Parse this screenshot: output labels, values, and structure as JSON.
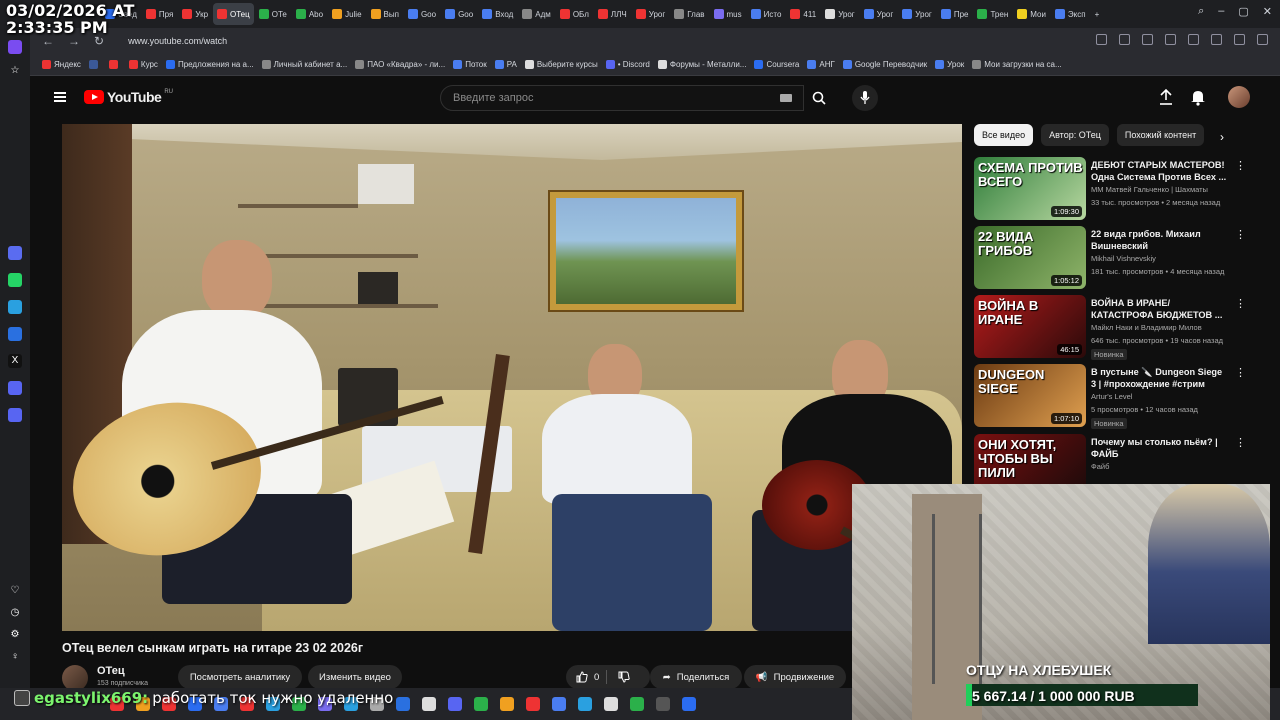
{
  "overlay_timestamp": {
    "date": "03/02/2026 AT",
    "time": "2:33:35 PM"
  },
  "browser": {
    "tabs": [
      {
        "label": "Свед",
        "color": "#2b6cf0"
      },
      {
        "label": "Пря",
        "color": "#e33"
      },
      {
        "label": "Укр",
        "color": "#e33"
      },
      {
        "label": "ОТец",
        "color": "#e33",
        "active": true
      },
      {
        "label": "ОТе",
        "color": "#2bb04a"
      },
      {
        "label": "Abo",
        "color": "#2bb04a"
      },
      {
        "label": "Julie",
        "color": "#f0a020"
      },
      {
        "label": "Вып",
        "color": "#f0a020"
      },
      {
        "label": "Goo",
        "color": "#4a7df0"
      },
      {
        "label": "Goo",
        "color": "#4a7df0"
      },
      {
        "label": "Вход",
        "color": "#4a7df0"
      },
      {
        "label": "Адм",
        "color": "#888"
      },
      {
        "label": "ОБл",
        "color": "#e33"
      },
      {
        "label": "ЛЛЧ",
        "color": "#e33"
      },
      {
        "label": "Урог",
        "color": "#e33"
      },
      {
        "label": "Глав",
        "color": "#888"
      },
      {
        "label": "mus",
        "color": "#7a6cf0"
      },
      {
        "label": "Исто",
        "color": "#4a7df0"
      },
      {
        "label": "411",
        "color": "#e33"
      },
      {
        "label": "Урог",
        "color": "#ddd"
      },
      {
        "label": "Урог",
        "color": "#4a7df0"
      },
      {
        "label": "Урог",
        "color": "#4a7df0"
      },
      {
        "label": "Пре",
        "color": "#4a7df0"
      },
      {
        "label": "Трен",
        "color": "#2bb04a"
      },
      {
        "label": "Мои",
        "color": "#f0d020"
      },
      {
        "label": "Эксп",
        "color": "#4a7df0"
      }
    ],
    "new_tab": "+",
    "url": "www.youtube.com/watch",
    "bookmarks": [
      {
        "label": "Яндекс",
        "color": "#e33"
      },
      {
        "label": "",
        "color": "#3b5998"
      },
      {
        "label": "",
        "color": "#e33"
      },
      {
        "label": "Курс",
        "color": "#e33"
      },
      {
        "label": "Предложения на а...",
        "color": "#2b6cf0"
      },
      {
        "label": "Личный кабинет а...",
        "color": "#888"
      },
      {
        "label": "ПАО «Квадра» - ли...",
        "color": "#888"
      },
      {
        "label": "Поток",
        "color": "#4a7df0"
      },
      {
        "label": "PA",
        "color": "#4a7df0"
      },
      {
        "label": "Выберите курсы",
        "color": "#ddd"
      },
      {
        "label": "• Discord",
        "color": "#5865f2"
      },
      {
        "label": "Форумы - Металли...",
        "color": "#ddd"
      },
      {
        "label": "Coursera",
        "color": "#2b6cf0"
      },
      {
        "label": "АНГ",
        "color": "#4a7df0"
      },
      {
        "label": "Google Переводчик",
        "color": "#4a7df0"
      },
      {
        "label": "Урок",
        "color": "#4a7df0"
      },
      {
        "label": "Мои загрузки на са...",
        "color": "#888"
      }
    ]
  },
  "youtube": {
    "logo_text": "YouTube",
    "logo_region": "RU",
    "search_placeholder": "Введите запрос",
    "video_title": "ОТец велел сынкам играть на гитаре 23 02 2026г",
    "channel_name": "ОТец",
    "channel_subs": "153 подписчика",
    "buttons": {
      "analytics": "Посмотреть аналитику",
      "edit": "Изменить видео",
      "like_count": "0",
      "share": "Поделиться",
      "promote": "Продвижение"
    },
    "chips": [
      "Все видео",
      "Автор: ОТец",
      "Похожий контент"
    ],
    "recommendations": [
      {
        "title": "ДЕБЮТ СТАРЫХ МАСТЕРОВ! Одна Система Против Всех ...",
        "channel": "ММ Матвей Гальченко | Шахматы",
        "meta": "33 тыс. просмотров • 2 месяца назад",
        "duration": "1:09:30",
        "thumb_text": "СХЕМА ПРОТИВ ВСЕГО",
        "thumb_bg": "linear-gradient(135deg,#2f7d3a,#b7d7a0)",
        "badge": ""
      },
      {
        "title": "22 вида грибов. Михаил Вишневский",
        "channel": "Mikhail Vishnevskiy",
        "meta": "181 тыс. просмотров • 4 месяца назад",
        "duration": "1:05:12",
        "thumb_text": "22 ВИДА ГРИБОВ",
        "thumb_bg": "linear-gradient(135deg,#3b6b2a,#8fb46a)",
        "badge": ""
      },
      {
        "title": "ВОЙНА В ИРАНЕ/ КАТАСТРОФА БЮДЖЕТОВ ...",
        "channel": "Майкл Наки  и Владимир Милов",
        "meta": "646 тыс. просмотров • 19 часов назад",
        "duration": "46:15",
        "thumb_text": "ВОЙНА В ИРАНЕ",
        "thumb_bg": "linear-gradient(135deg,#b31b1b,#2a0a0a)",
        "badge": "Новинка"
      },
      {
        "title": "В пустыне 🔪 Dungeon Siege 3 | #прохождение #стрим",
        "channel": "Artur's Level",
        "meta": "5 просмотров • 12 часов назад",
        "duration": "1:07:10",
        "thumb_text": "DUNGEON SIEGE",
        "thumb_bg": "linear-gradient(135deg,#6b3a12,#e0a050)",
        "badge": "Новинка"
      },
      {
        "title": "Почему мы столько пьём? | ФАЙБ",
        "channel": "Файб",
        "meta": "",
        "duration": "",
        "thumb_text": "ОНИ ХОТЯТ, ЧТОБЫ ВЫ ПИЛИ",
        "thumb_bg": "linear-gradient(135deg,#7a1010,#1a0a0a)",
        "badge": ""
      }
    ]
  },
  "webcam": {
    "label": "ОТЦУ НА ХЛЕБУШЕК",
    "goal": "5 667.14 / 1 000 000 RUB"
  },
  "chat": {
    "user": "egastylix669:",
    "message": "работать ток нужно удаленно"
  }
}
